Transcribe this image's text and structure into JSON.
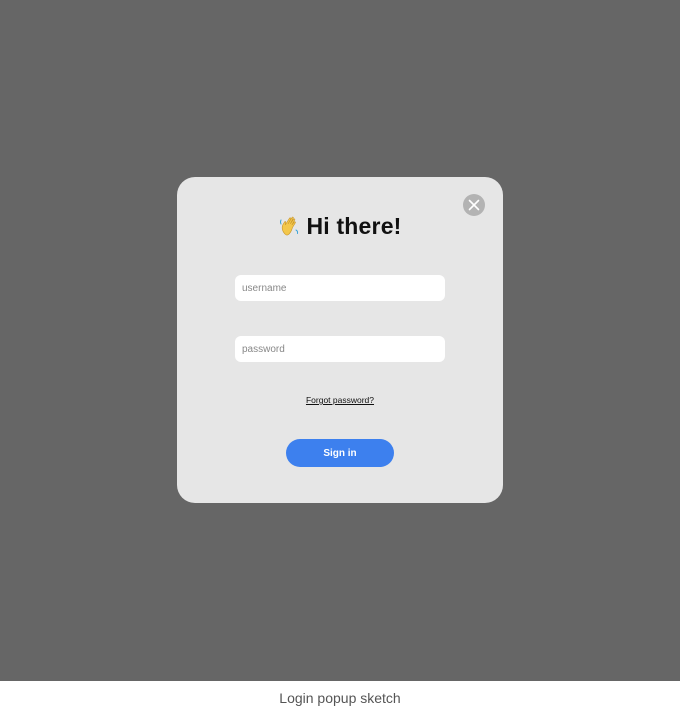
{
  "popup": {
    "close_icon": "close-icon",
    "greeting_emoji": "waving-hand-icon",
    "title": "Hi there!",
    "username_placeholder": "username",
    "username_value": "",
    "password_placeholder": "password",
    "password_value": "",
    "forgot_label": "Forgot password?",
    "signin_label": "Sign in"
  },
  "caption": "Login popup sketch",
  "colors": {
    "backdrop": "#666666",
    "popup_bg": "#e6e6e6",
    "close_bg": "#b3b3b3",
    "signin_bg": "#3d80ee"
  }
}
